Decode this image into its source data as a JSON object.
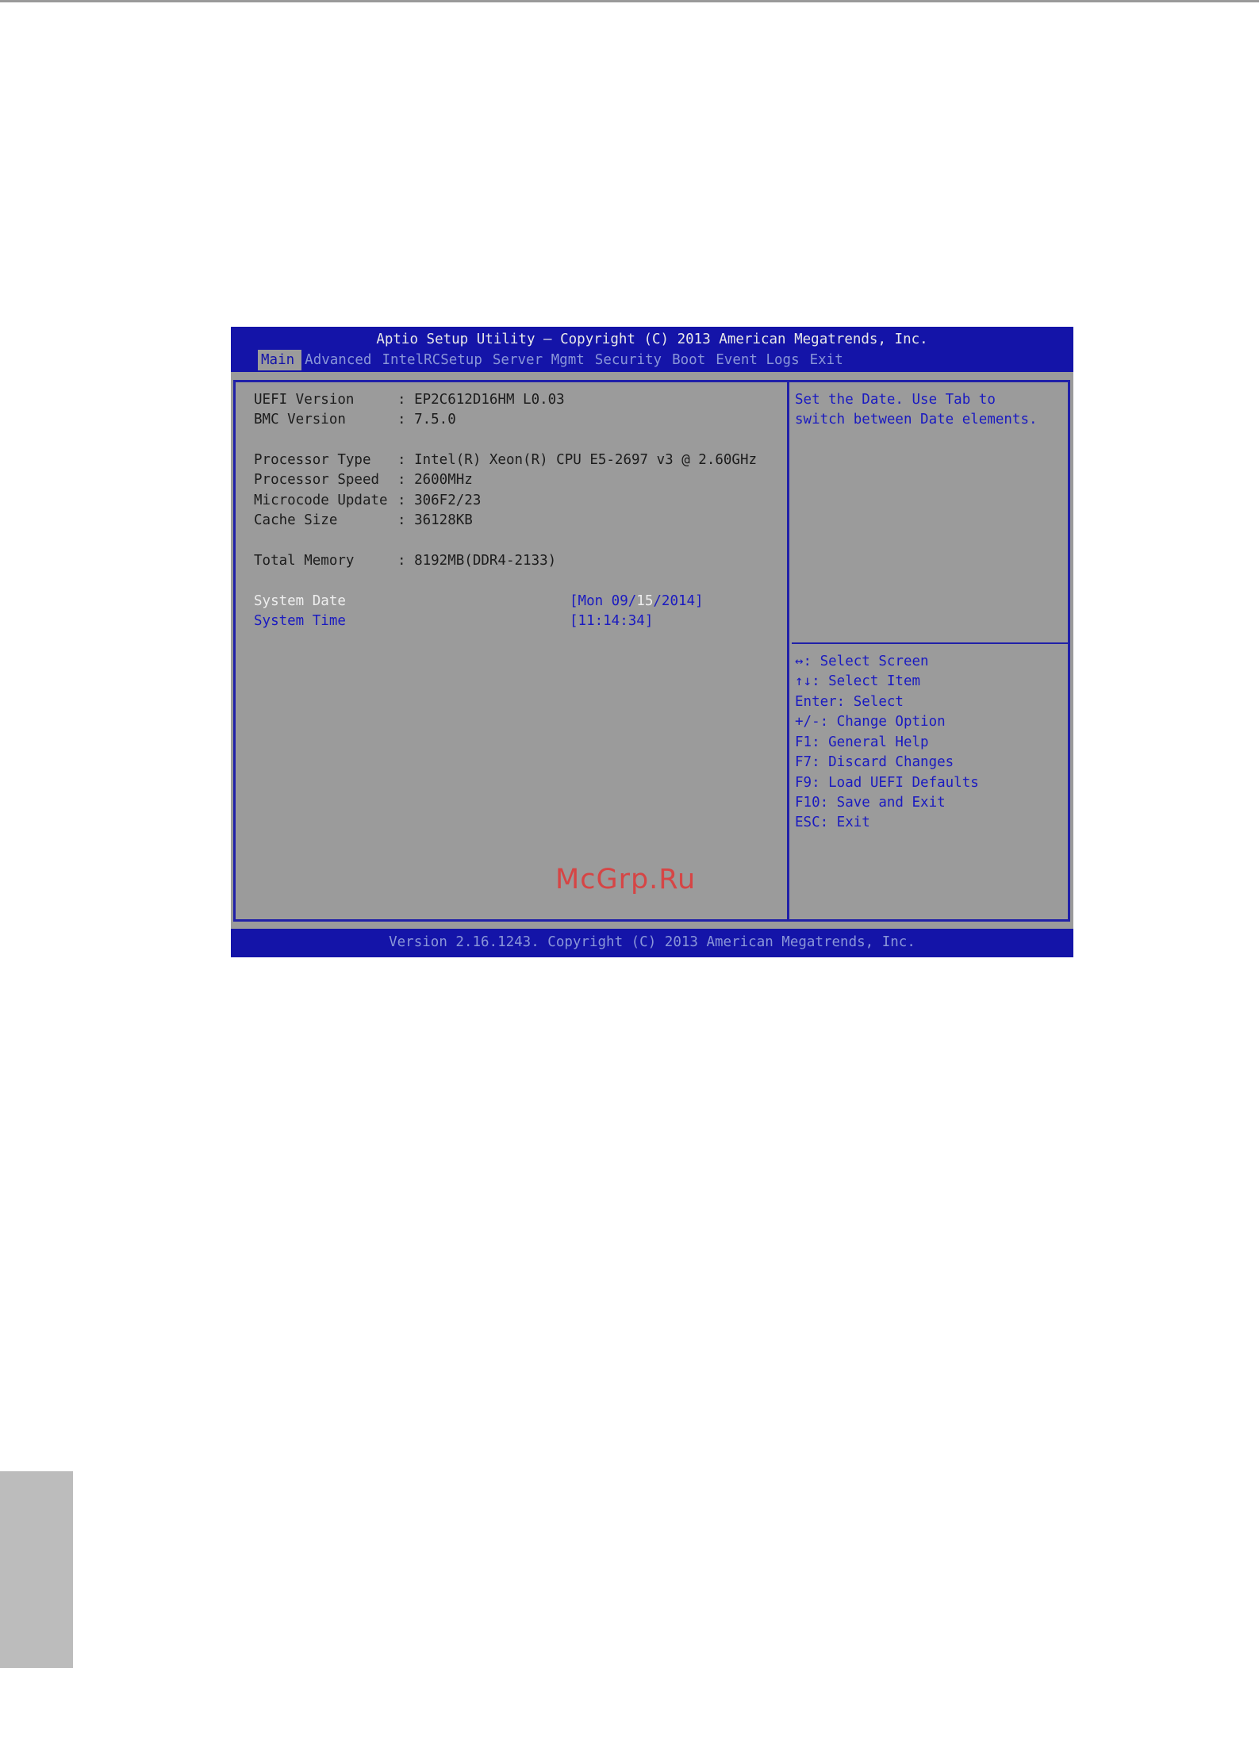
{
  "header": {
    "title": "Aptio Setup Utility – Copyright (C) 2013 American Megatrends, Inc.",
    "tabs": [
      {
        "label": "Main",
        "active": true
      },
      {
        "label": "Advanced",
        "active": false
      },
      {
        "label": "IntelRCSetup",
        "active": false
      },
      {
        "label": "Server Mgmt",
        "active": false
      },
      {
        "label": "Security",
        "active": false
      },
      {
        "label": "Boot",
        "active": false
      },
      {
        "label": "Event Logs",
        "active": false
      },
      {
        "label": "Exit",
        "active": false
      }
    ]
  },
  "info": {
    "uefi_version": {
      "label": "UEFI Version",
      "value": ": EP2C612D16HM L0.03"
    },
    "bmc_version": {
      "label": "BMC Version",
      "value": ": 7.5.0"
    },
    "processor_type": {
      "label": "Processor Type",
      "value": ": Intel(R) Xeon(R) CPU E5-2697 v3 @ 2.60GHz"
    },
    "processor_speed": {
      "label": "Processor Speed",
      "value": ": 2600MHz"
    },
    "microcode_update": {
      "label": "Microcode Update",
      "value": ": 306F2/23"
    },
    "cache_size": {
      "label": "Cache Size",
      "value": ": 36128KB"
    },
    "total_memory": {
      "label": "Total Memory",
      "value": ": 8192MB(DDR4-2133)"
    }
  },
  "settings": {
    "system_date": {
      "label": "System Date",
      "value_prefix": "[Mon 09/",
      "value_highlight": "15",
      "value_suffix": "/2014]"
    },
    "system_time": {
      "label": "System Time",
      "value": "[11:14:34]"
    }
  },
  "help": {
    "line1": "Set the Date. Use Tab to",
    "line2": "switch between Date elements."
  },
  "keys": [
    "↔: Select Screen",
    "↑↓: Select Item",
    "Enter: Select",
    "+/-: Change Option",
    "F1: General Help",
    "F7: Discard Changes",
    "F9: Load UEFI Defaults",
    "F10: Save and Exit",
    "ESC: Exit"
  ],
  "footer": {
    "text": "Version 2.16.1243. Copyright (C) 2013 American Megatrends, Inc."
  },
  "watermark": "McGrp.Ru",
  "colors": {
    "bios_blue": "#1414a8",
    "bios_gray": "#9b9b9b",
    "selected_text": "#eeeeee",
    "watermark_red": "#d64545"
  }
}
